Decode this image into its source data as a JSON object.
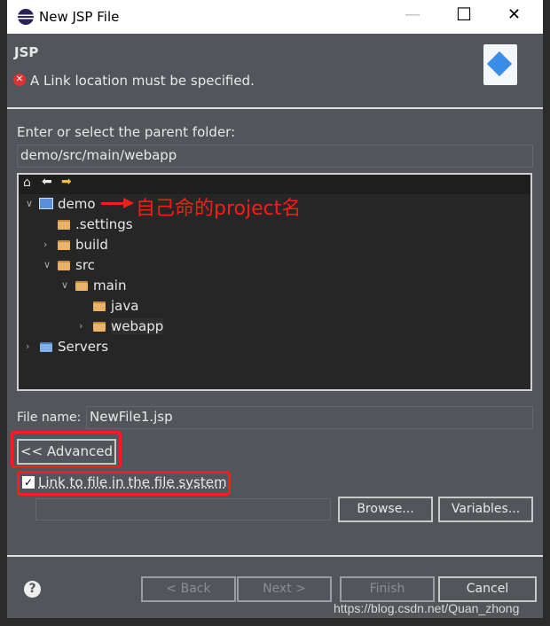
{
  "window": {
    "title": "New JSP File"
  },
  "header": {
    "title": "JSP",
    "error": "A Link location must be specified."
  },
  "parent_folder": {
    "label": "Enter or select the parent folder:",
    "value": "demo/src/main/webapp"
  },
  "tree": {
    "items": [
      {
        "label": "demo",
        "expanded": true,
        "icon": "project-icon"
      },
      {
        "label": ".settings",
        "icon": "folder-icon"
      },
      {
        "label": "build",
        "expanded": false,
        "icon": "folder-icon"
      },
      {
        "label": "src",
        "expanded": true,
        "icon": "folder-icon"
      },
      {
        "label": "main",
        "expanded": true,
        "icon": "folder-icon"
      },
      {
        "label": "java",
        "icon": "folder-icon"
      },
      {
        "label": "webapp",
        "expanded": false,
        "selected": true,
        "icon": "folder-icon"
      },
      {
        "label": "Servers",
        "expanded": false,
        "icon": "folder-icon"
      }
    ],
    "annotation": "自己命的project名"
  },
  "file_name": {
    "label": "File name:",
    "value": "NewFile1.jsp"
  },
  "advanced_label": "<< Advanced",
  "link": {
    "label": "Link to file in the file system",
    "checked": true,
    "value": ""
  },
  "buttons": {
    "browse": "Browse...",
    "variables": "Variables...",
    "back": "< Back",
    "next": "Next >",
    "finish": "Finish",
    "cancel": "Cancel"
  },
  "watermark": "https://blog.csdn.net/Quan_zhong",
  "colors": {
    "annotation": "#ff1a1a",
    "dialog_bg": "#52565a"
  }
}
